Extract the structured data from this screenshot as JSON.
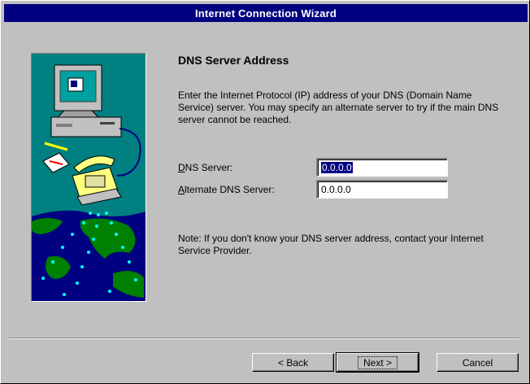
{
  "window": {
    "title": "Internet Connection Wizard"
  },
  "page": {
    "heading": "DNS Server Address",
    "intro": "Enter the Internet Protocol (IP) address of your DNS (Domain Name Service) server.  You may specify an alternate server to try if the main DNS server cannot be reached.",
    "note": "Note: If you don't know your DNS server address, contact your Internet Service Provider."
  },
  "fields": {
    "dns": {
      "accel": "D",
      "label_rest": "NS Server:",
      "value": "0.0.0.0"
    },
    "alternate": {
      "accel": "A",
      "label_rest": "lternate DNS Server:",
      "value": "0.0.0.0"
    }
  },
  "buttons": {
    "back": "< Back",
    "next": "Next >",
    "cancel": "Cancel"
  },
  "colors": {
    "titlebar": "#000080",
    "face": "#c0c0c0",
    "art_background": "#008080"
  }
}
